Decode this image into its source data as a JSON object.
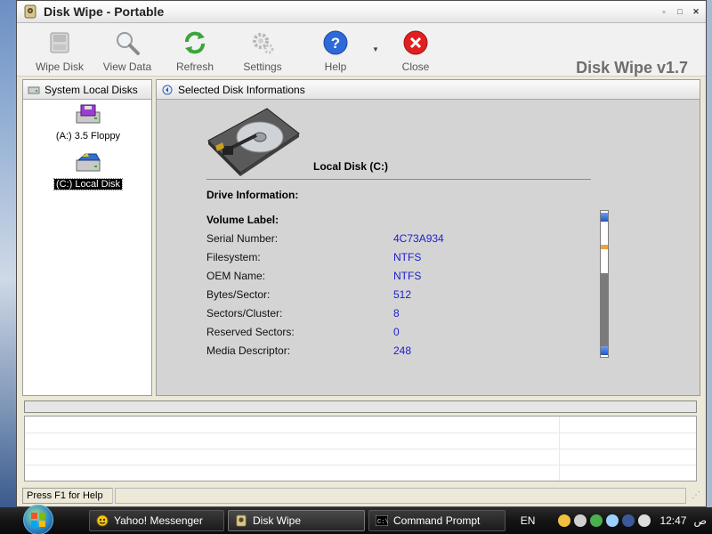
{
  "window": {
    "title": "Disk Wipe  - Portable",
    "min_glyph": "▫",
    "max_glyph": "□",
    "close_glyph": "✕"
  },
  "toolbar": {
    "buttons": [
      {
        "label": "Wipe Disk",
        "icon": "wipe-disk-icon"
      },
      {
        "label": "View Data",
        "icon": "magnifier-icon"
      },
      {
        "label": "Refresh",
        "icon": "refresh-icon"
      },
      {
        "label": "Settings",
        "icon": "gear-icon"
      },
      {
        "label": "Help",
        "icon": "help-icon"
      },
      {
        "label": "Close",
        "icon": "close-icon"
      }
    ],
    "dropdown_glyph": "▼",
    "brand": "Disk Wipe v1.7"
  },
  "left_panel": {
    "header": "System Local Disks",
    "drives": [
      {
        "label": "(A:) 3.5 Floppy",
        "selected": false
      },
      {
        "label": "(C:) Local Disk",
        "selected": true
      }
    ]
  },
  "right_panel": {
    "header": "Selected Disk Informations",
    "disk_title": "Local Disk  (C:)",
    "drive_info_heading": "Drive Information:",
    "volume_label_heading": "Volume Label:",
    "rows": [
      {
        "key": "Serial Number:",
        "value": "4C73A934"
      },
      {
        "key": "Filesystem:",
        "value": "NTFS"
      },
      {
        "key": "OEM Name:",
        "value": "NTFS"
      },
      {
        "key": "Bytes/Sector:",
        "value": "512"
      },
      {
        "key": "Sectors/Cluster:",
        "value": "8"
      },
      {
        "key": "Reserved Sectors:",
        "value": "0"
      },
      {
        "key": "Media Descriptor:",
        "value": "248"
      }
    ]
  },
  "statusbar": {
    "text": "Press F1 for Help"
  },
  "taskbar": {
    "tasks": [
      {
        "label": "Yahoo! Messenger",
        "icon": "yahoo-messenger-icon"
      },
      {
        "label": "Disk Wipe",
        "icon": "disk-wipe-app-icon"
      },
      {
        "label": "Command Prompt",
        "icon": "command-prompt-icon"
      }
    ],
    "lang": "EN",
    "clock": "12:47",
    "clock_suffix": "ص"
  },
  "colors": {
    "value_blue": "#1d1dcc",
    "panel_gray": "#d4d4d4",
    "brand_gray": "#6e6e6e"
  }
}
